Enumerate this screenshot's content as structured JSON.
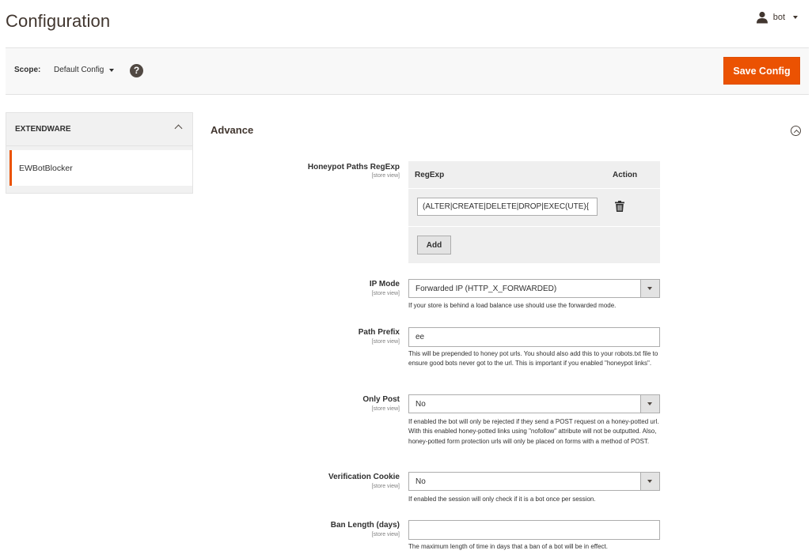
{
  "header": {
    "title": "Configuration",
    "user": "bot"
  },
  "scope_bar": {
    "scope_label": "Scope:",
    "scope_value": "Default Config",
    "help_glyph": "?",
    "save_label": "Save Config",
    "accent_color": "#eb5202"
  },
  "sidebar": {
    "group_label": "EXTENDWARE",
    "items": [
      {
        "label": "EWBotBlocker",
        "active": true
      }
    ]
  },
  "section": {
    "title": "Advance",
    "fields": {
      "honeypot_paths": {
        "label": "Honeypot Paths RegExp",
        "scope": "[store view]",
        "table": {
          "headers": [
            "RegExp",
            "Action"
          ],
          "rows": [
            {
              "regexp": "(ALTER|CREATE|DELETE|DROP|EXEC(UTE){"
            }
          ],
          "add_label": "Add"
        }
      },
      "ip_mode": {
        "label": "IP Mode",
        "scope": "[store view]",
        "value": "Forwarded IP (HTTP_X_FORWARDED)",
        "note": "If your store is behind a load balance use should use the forwarded mode."
      },
      "path_prefix": {
        "label": "Path Prefix",
        "scope": "[store view]",
        "value": "ee",
        "note": "This will be prepended to honey pot urls. You should also add this to your robots.txt file to ensure good bots never got to the url. This is important if you enabled \"honeypot links\"."
      },
      "only_post": {
        "label": "Only Post",
        "scope": "[store view]",
        "value": "No",
        "note": "If enabled the bot will only be rejected if they send a POST request on a honey-potted url. With this enabled honey-potted links using \"nofollow\" attribute will not be outputted. Also, honey-potted form protection urls will only be placed on forms with a method of POST."
      },
      "verification_cookie": {
        "label": "Verification Cookie",
        "scope": "[store view]",
        "value": "No",
        "note": "If enabled the session will only check if it is a bot once per session."
      },
      "ban_length": {
        "label": "Ban Length (days)",
        "scope": "[store view]",
        "value": "",
        "note": "The maximum length of time in days that a ban of a bot will be in effect."
      }
    }
  }
}
